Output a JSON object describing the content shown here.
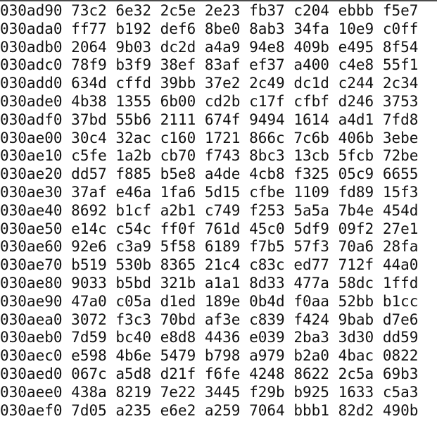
{
  "hexdump": {
    "rows": [
      {
        "offset": "030ad90",
        "words": [
          "73c2",
          "6e32",
          "2c5e",
          "2e23",
          "fb37",
          "c204",
          "ebbb",
          "f5e7"
        ]
      },
      {
        "offset": "030ada0",
        "words": [
          "ff77",
          "b192",
          "def6",
          "8be0",
          "8ab3",
          "34fa",
          "10e9",
          "c0ff"
        ]
      },
      {
        "offset": "030adb0",
        "words": [
          "2064",
          "9b03",
          "dc2d",
          "a4a9",
          "94e8",
          "409b",
          "e495",
          "8f54"
        ]
      },
      {
        "offset": "030adc0",
        "words": [
          "78f9",
          "b3f9",
          "38ef",
          "83af",
          "ef37",
          "a400",
          "c4e8",
          "55f1"
        ]
      },
      {
        "offset": "030add0",
        "words": [
          "634d",
          "cffd",
          "39bb",
          "37e2",
          "2c49",
          "dc1d",
          "c244",
          "2c34"
        ]
      },
      {
        "offset": "030ade0",
        "words": [
          "4b38",
          "1355",
          "6b00",
          "cd2b",
          "c17f",
          "cfbf",
          "d246",
          "3753"
        ]
      },
      {
        "offset": "030adf0",
        "words": [
          "37bd",
          "55b6",
          "2111",
          "674f",
          "9494",
          "1614",
          "a4d1",
          "7fd8"
        ]
      },
      {
        "offset": "030ae00",
        "words": [
          "30c4",
          "32ac",
          "c160",
          "1721",
          "866c",
          "7c6b",
          "406b",
          "3ebe"
        ]
      },
      {
        "offset": "030ae10",
        "words": [
          "c5fe",
          "1a2b",
          "cb70",
          "f743",
          "8bc3",
          "13cb",
          "5fcb",
          "72be"
        ]
      },
      {
        "offset": "030ae20",
        "words": [
          "dd57",
          "f885",
          "b5e8",
          "a4de",
          "4cb8",
          "f325",
          "05c9",
          "6655"
        ]
      },
      {
        "offset": "030ae30",
        "words": [
          "37af",
          "e46a",
          "1fa6",
          "5d15",
          "cfbe",
          "1109",
          "fd89",
          "15f3"
        ]
      },
      {
        "offset": "030ae40",
        "words": [
          "8692",
          "b1cf",
          "a2b1",
          "c749",
          "f253",
          "5a5a",
          "7b4e",
          "454d"
        ]
      },
      {
        "offset": "030ae50",
        "words": [
          "e14c",
          "c54c",
          "ff0f",
          "761d",
          "45c0",
          "5df9",
          "09f2",
          "27e1"
        ]
      },
      {
        "offset": "030ae60",
        "words": [
          "92e6",
          "c3a9",
          "5f58",
          "6189",
          "f7b5",
          "57f3",
          "70a6",
          "28fa"
        ]
      },
      {
        "offset": "030ae70",
        "words": [
          "b519",
          "530b",
          "8365",
          "21c4",
          "c83c",
          "ed77",
          "712f",
          "44a0"
        ]
      },
      {
        "offset": "030ae80",
        "words": [
          "9033",
          "b5bd",
          "321b",
          "a1a1",
          "8d33",
          "477a",
          "58dc",
          "1ffd"
        ]
      },
      {
        "offset": "030ae90",
        "words": [
          "47a0",
          "c05a",
          "d1ed",
          "189e",
          "0b4d",
          "f0aa",
          "52bb",
          "b1cc"
        ]
      },
      {
        "offset": "030aea0",
        "words": [
          "3072",
          "f3c3",
          "70bd",
          "af3e",
          "c839",
          "f424",
          "9bab",
          "d7e6"
        ]
      },
      {
        "offset": "030aeb0",
        "words": [
          "7d59",
          "bc40",
          "e8d8",
          "4436",
          "e039",
          "2ba3",
          "3d30",
          "dd59"
        ]
      },
      {
        "offset": "030aec0",
        "words": [
          "e598",
          "4b6e",
          "5479",
          "b798",
          "a979",
          "b2a0",
          "4bac",
          "0822"
        ]
      },
      {
        "offset": "030aed0",
        "words": [
          "067c",
          "a5d8",
          "d21f",
          "f6fe",
          "4248",
          "8622",
          "2c5a",
          "69b3"
        ]
      },
      {
        "offset": "030aee0",
        "words": [
          "438a",
          "8219",
          "7e22",
          "3445",
          "f29b",
          "b925",
          "1633",
          "c5a3"
        ]
      },
      {
        "offset": "030aef0",
        "words": [
          "7d05",
          "a235",
          "e6e2",
          "a259",
          "7064",
          "bbb1",
          "82d2",
          "490b"
        ]
      }
    ]
  }
}
